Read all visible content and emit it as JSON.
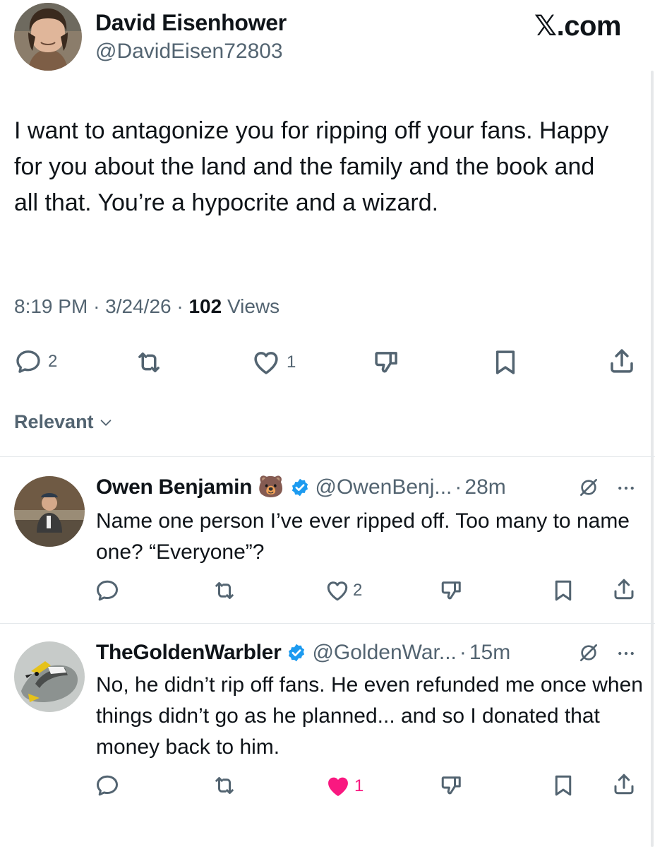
{
  "brand": {
    "x": "𝕏",
    "suffix": ".com"
  },
  "tweet": {
    "author_name": "David Eisenhower",
    "author_handle": "@DavidEisen72803",
    "text": "I want to antagonize you for ripping off your fans. Happy for you about the land and the family and the book and all that. You’re a hypocrite and a wizard.",
    "time": "8:19 PM",
    "date": "3/24/26",
    "sep": "·",
    "views_count": "102",
    "views_label": "Views",
    "replies": "2",
    "likes": "1"
  },
  "sort": {
    "label": "Relevant"
  },
  "replies": [
    {
      "name": "Owen Benjamin",
      "emoji": "🐻",
      "handle": "@OwenBenj...",
      "sep": "·",
      "time": "28m",
      "text": "Name one person I’ve ever ripped off. Too many to name one? “Everyone”?",
      "likes": "2",
      "liked": false
    },
    {
      "name": "TheGoldenWarbler",
      "handle": "@GoldenWar...",
      "sep": "·",
      "time": "15m",
      "text": "No, he didn’t rip off fans. He even refunded me once when things didn’t go as he planned... and so I donated that money back to him.",
      "likes": "1",
      "liked": true
    }
  ],
  "colors": {
    "muted": "#536471",
    "text": "#0f1419",
    "verified": "#1d9bf0",
    "liked": "#f91880",
    "divider": "#e4e8eb"
  }
}
